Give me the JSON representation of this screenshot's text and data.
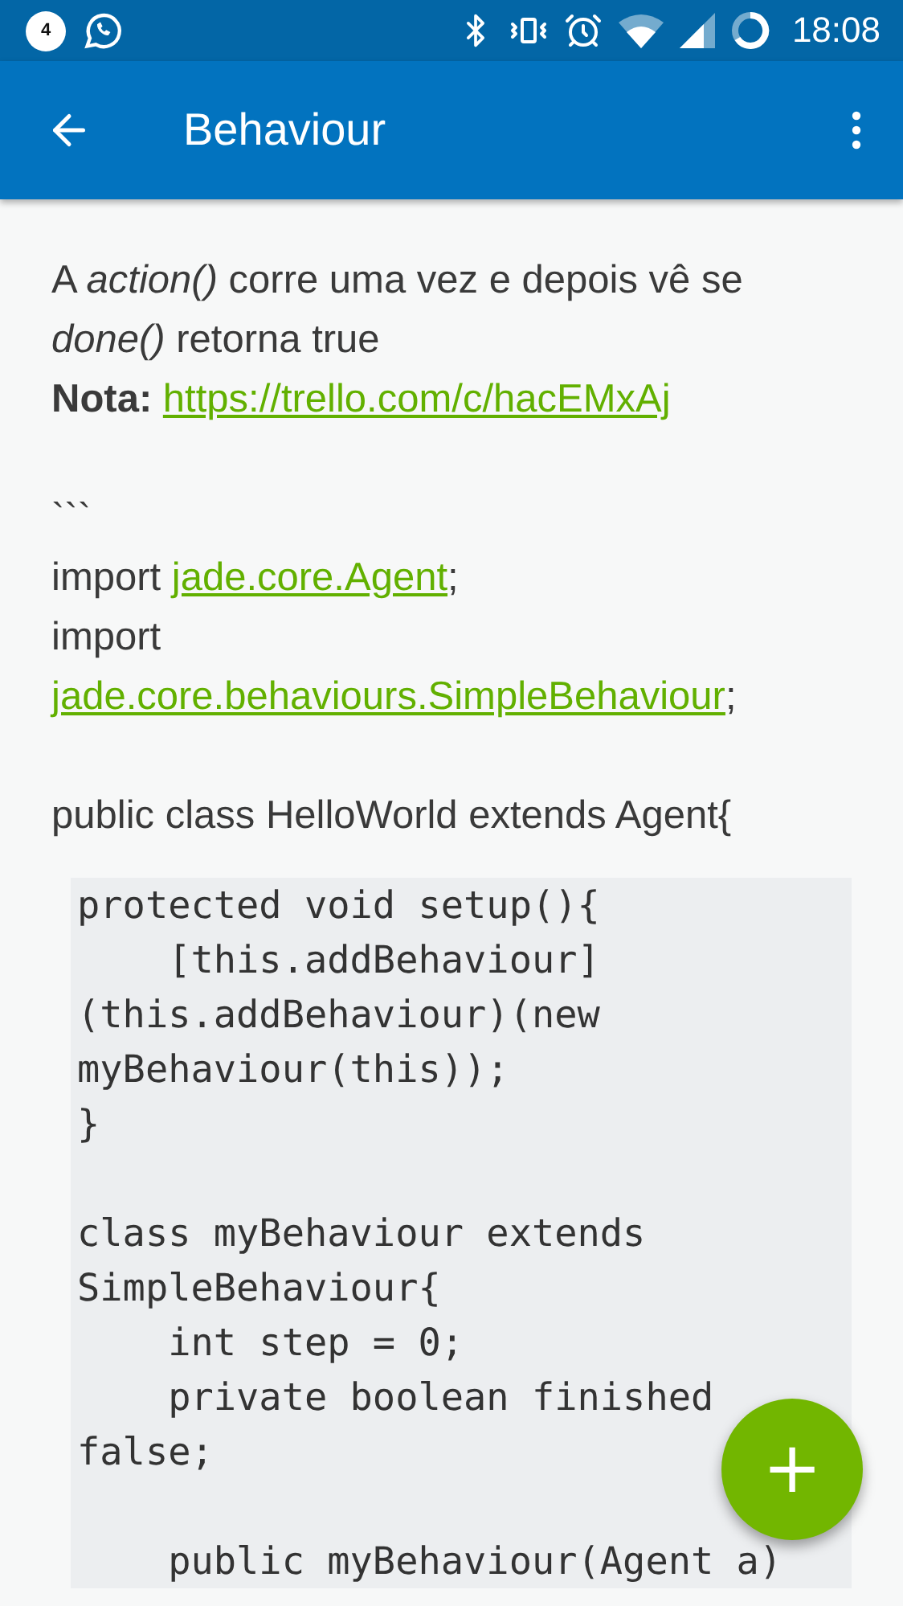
{
  "status_bar": {
    "notification_count": "4",
    "time": "18:08"
  },
  "app_bar": {
    "title": "Behaviour"
  },
  "sections": [
    {
      "kind": "text",
      "paras": [
        {
          "parts": [
            {
              "kind": "text",
              "text": "A *action()* corre uma vez e depois vê se *done()* retorna true"
            }
          ]
        },
        {
          "parts": [
            {
              "kind": "text",
              "text": "**Nota:**"
            },
            {
              "kind": "link",
              "text": "https://trello.com/c/hacEMxAj"
            }
          ]
        }
      ]
    },
    {
      "kind": "text",
      "paras": [
        {
          "parts": [
            {
              "kind": "text",
              "text": "```"
            }
          ]
        },
        {
          "parts": [
            {
              "kind": "text",
              "text": "import"
            },
            {
              "kind": "link",
              "text": "jade.core.Agent"
            },
            {
              "kind": "suffix",
              "text": ";"
            }
          ]
        },
        {
          "parts": [
            {
              "kind": "text",
              "text": "import"
            },
            {
              "kind": "link",
              "text": "jade.core.behaviours.SimpleBehaviour"
            },
            {
              "kind": "suffix",
              "text": ";"
            }
          ]
        }
      ]
    },
    {
      "kind": "text",
      "paras": [
        {
          "parts": [
            {
              "kind": "text",
              "text": "public class HelloWorld extends Agent{"
            }
          ]
        }
      ]
    },
    {
      "kind": "code",
      "groups": [
        [
          "protected void setup(){",
          "    [this.addBehaviour]",
          "(this.addBehaviour)(new",
          "myBehaviour(this));",
          "}"
        ],
        [
          "class myBehaviour extends",
          "SimpleBehaviour{",
          "    int step = 0;",
          "    private boolean finished",
          "false;"
        ],
        [
          "    public myBehaviour(Agent a)"
        ]
      ]
    }
  ],
  "fab": {
    "label": "+"
  }
}
